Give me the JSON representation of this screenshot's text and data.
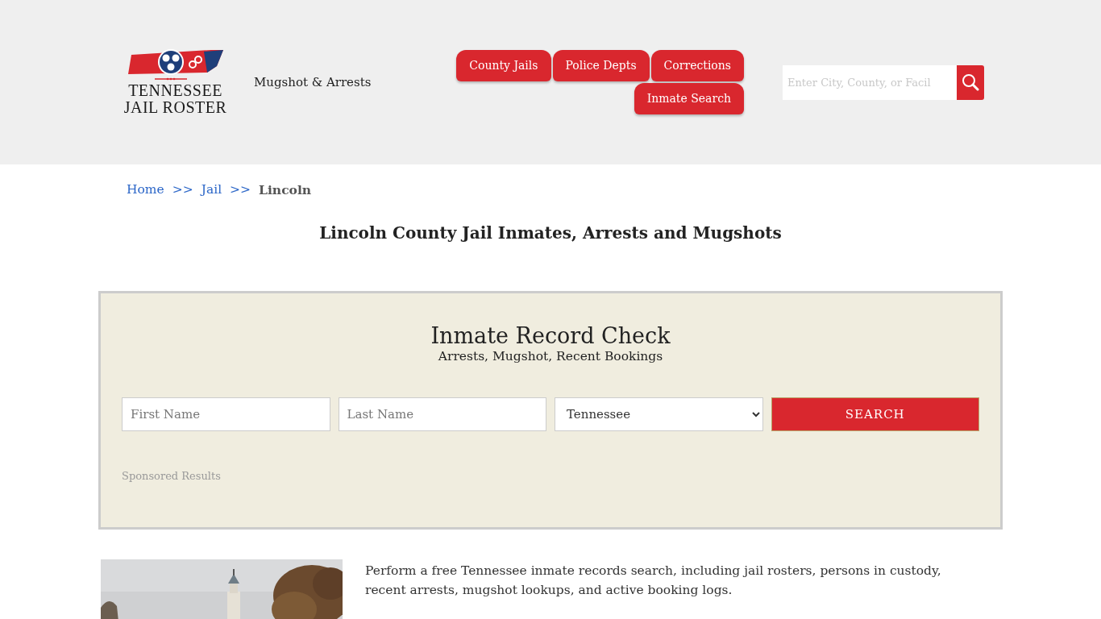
{
  "logo": {
    "line_1": "TENNESSEE",
    "line_2": "JAIL ROSTER"
  },
  "tagline": "Mugshot & Arrests",
  "nav": [
    {
      "label": "County Jails"
    },
    {
      "label": "Police Depts"
    },
    {
      "label": "Corrections"
    },
    {
      "label": "Inmate Search"
    }
  ],
  "site_search": {
    "placeholder": "Enter City, County, or Facil"
  },
  "breadcrumb": [
    {
      "label": "Home",
      "kind": "link"
    },
    {
      "label": ">>",
      "kind": "separator"
    },
    {
      "label": "Jail",
      "kind": "link"
    },
    {
      "label": ">>",
      "kind": "separator"
    },
    {
      "label": "Lincoln",
      "kind": "current"
    }
  ],
  "page_title": "Lincoln County Jail Inmates, Arrests and Mugshots",
  "record_check": {
    "title": "Inmate Record Check",
    "subtitle": "Arrests, Mugshot, Recent Bookings",
    "first_name": {
      "placeholder": "First Name"
    },
    "last_name": {
      "placeholder": "Last Name"
    },
    "state": {
      "value": "Tennessee"
    },
    "button": "SEARCH",
    "sponsored": "Sponsored Results"
  },
  "intro": {
    "paragraph": "Perform a free Tennessee inmate records search, including jail rosters, persons in custody, recent arrests, mugshot lookups, and active booking logs."
  }
}
